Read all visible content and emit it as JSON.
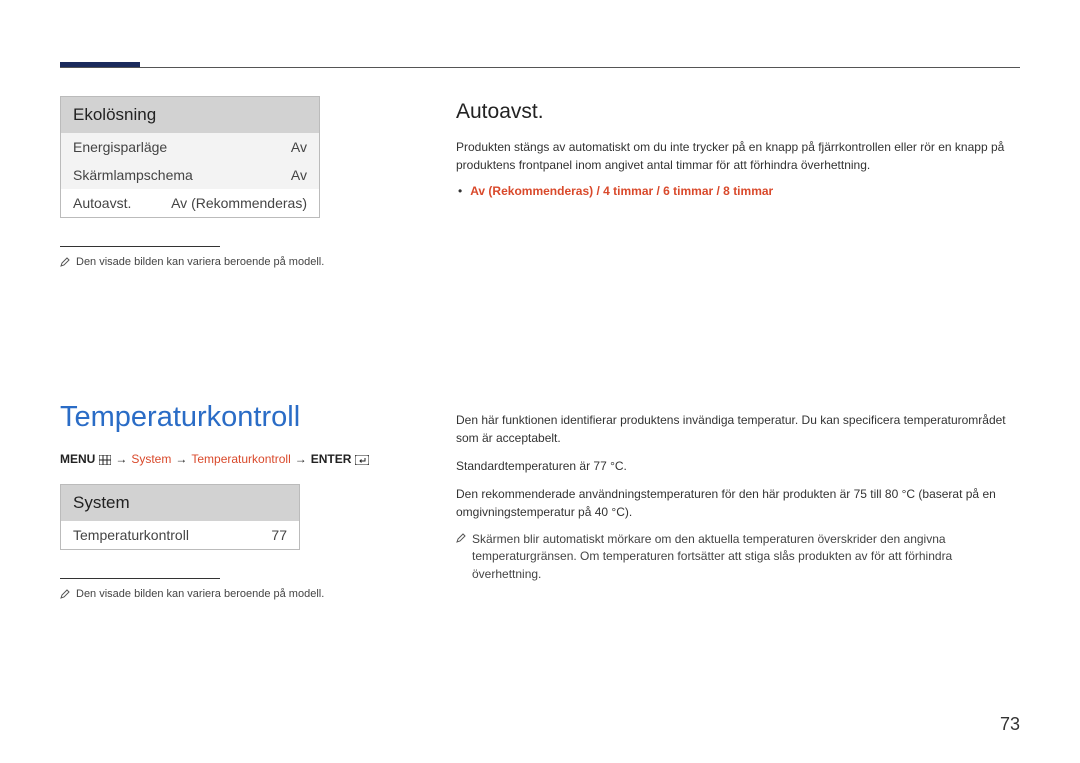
{
  "panel1": {
    "title": "Ekolösning",
    "rows": [
      {
        "label": "Energisparläge",
        "value": "Av"
      },
      {
        "label": "Skärmlampschema",
        "value": "Av"
      },
      {
        "label": "Autoavst.",
        "value": "Av (Rekommenderas)"
      }
    ]
  },
  "note1": "Den visade bilden kan variera beroende på modell.",
  "rightA": {
    "title": "Autoavst.",
    "para": "Produkten stängs av automatiskt om du inte trycker på en knapp på fjärrkontrollen eller rör en knapp på produktens frontpanel inom angivet antal timmar för att förhindra överhettning.",
    "bullet": "Av (Rekommenderas) / 4 timmar / 6 timmar / 8 timmar"
  },
  "leftB": {
    "title": "Temperaturkontroll",
    "path": {
      "menu": "MENU",
      "seg1": "System",
      "seg2": "Temperaturkontroll",
      "enter": "ENTER"
    },
    "panel": {
      "title": "System",
      "rowLabel": "Temperaturkontroll",
      "rowValue": "77"
    },
    "note": "Den visade bilden kan variera beroende på modell."
  },
  "rightB": {
    "p1": "Den här funktionen identifierar produktens invändiga temperatur. Du kan specificera temperaturområdet som är acceptabelt.",
    "p2": "Standardtemperaturen är 77 °C.",
    "p3": "Den rekommenderade användningstemperaturen för den här produkten är 75 till 80 °C (baserat på en omgivningstemperatur på 40 °C).",
    "noteA": "Skärmen blir automatiskt mörkare om den aktuella temperaturen överskrider den angivna temperaturgränsen. Om temperaturen fortsätter att stiga slås produkten av för att förhindra överhettning."
  },
  "pageNumber": "73"
}
